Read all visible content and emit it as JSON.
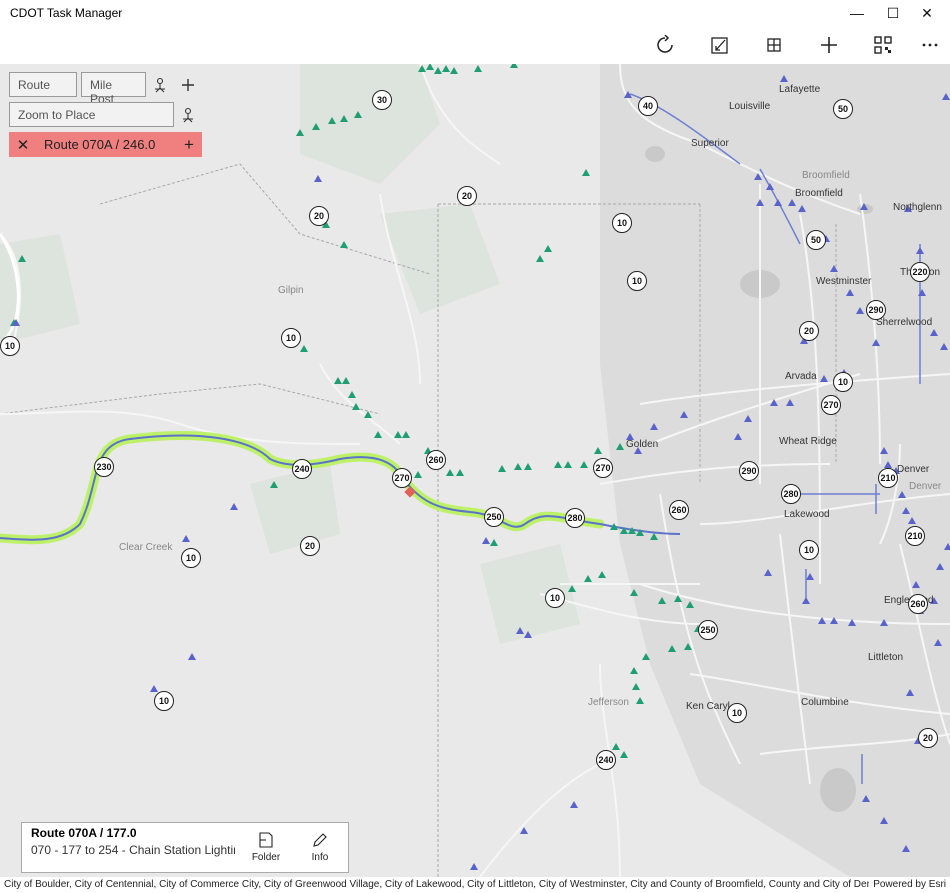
{
  "app": {
    "title": "CDOT Task Manager",
    "window_controls": [
      "minimize-icon",
      "maximize-icon",
      "close-icon"
    ]
  },
  "toolbar": {
    "buttons": [
      {
        "name": "refresh-icon",
        "glyph": "↻"
      },
      {
        "name": "edit-map-icon",
        "glyph": "✎"
      },
      {
        "name": "grid-icon",
        "glyph": "⊞"
      },
      {
        "name": "add-icon",
        "glyph": "+"
      },
      {
        "name": "qr-code-icon",
        "glyph": "▦"
      },
      {
        "name": "more-icon",
        "glyph": "⋯"
      }
    ]
  },
  "search": {
    "route_placeholder": "Route",
    "milepost_placeholder": "Mile Post",
    "zoom_placeholder": "Zoom to Place"
  },
  "active_route": {
    "label": "Route 070A / 246.0",
    "close_glyph": "✕",
    "add_glyph": "+"
  },
  "info_card": {
    "title": "Route 070A / 177.0",
    "subtitle": "070 - 177 to 254 - Chain Station Lighting",
    "folder_label": "Folder",
    "info_label": "Info"
  },
  "map": {
    "place_labels": [
      {
        "text": "Lafayette",
        "kind": "city"
      },
      {
        "text": "Louisville",
        "kind": "city"
      },
      {
        "text": "Superior",
        "kind": "city"
      },
      {
        "text": "Broomfield",
        "kind": "county"
      },
      {
        "text": "Broomfield",
        "kind": "city"
      },
      {
        "text": "Northglenn",
        "kind": "city"
      },
      {
        "text": "Gilpin",
        "kind": "county"
      },
      {
        "text": "Westminster",
        "kind": "city"
      },
      {
        "text": "Thornton",
        "kind": "city"
      },
      {
        "text": "Sherrelwood",
        "kind": "city"
      },
      {
        "text": "Arvada",
        "kind": "city"
      },
      {
        "text": "Golden",
        "kind": "city"
      },
      {
        "text": "Wheat Ridge",
        "kind": "city"
      },
      {
        "text": "Denver",
        "kind": "city"
      },
      {
        "text": "Denver",
        "kind": "county"
      },
      {
        "text": "Lakewood",
        "kind": "city"
      },
      {
        "text": "Clear Creek",
        "kind": "county"
      },
      {
        "text": "Englewood",
        "kind": "city"
      },
      {
        "text": "Littleton",
        "kind": "city"
      },
      {
        "text": "Jefferson",
        "kind": "county"
      },
      {
        "text": "Ken Caryl",
        "kind": "city"
      },
      {
        "text": "Columbine",
        "kind": "city"
      }
    ],
    "milepost_shields": [
      "30",
      "40",
      "50",
      "20",
      "20",
      "10",
      "10",
      "50",
      "220",
      "290",
      "10",
      "20",
      "10",
      "10",
      "270",
      "230",
      "240",
      "260",
      "270",
      "270",
      "290",
      "210",
      "250",
      "280",
      "260",
      "280",
      "210",
      "20",
      "10",
      "10",
      "260",
      "10",
      "250",
      "10",
      "10",
      "20",
      "240",
      "40"
    ],
    "highlight_color": "#b8f25a",
    "route_color": "#5b73c8",
    "asset_marker_colors": {
      "triangle_green": "#1f9e74",
      "triangle_blue": "#5a63c9"
    },
    "selected_marker_color": "#e0625a"
  },
  "attribution": {
    "text": "City of Boulder, City of Centennial, City of Commerce City, City of Greenwood Village, City of Lakewood, City of Littleton, City of Westminster, City and County of Broomfield, County and City of Denver, Co...",
    "powered_by": "Powered by Esri"
  }
}
